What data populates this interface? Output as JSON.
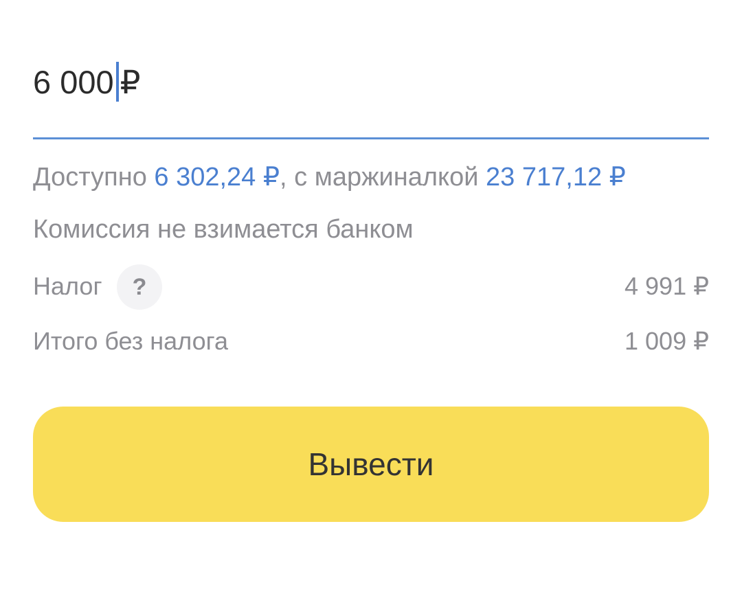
{
  "amount": {
    "value": "6 000",
    "currency": "₽"
  },
  "available": {
    "prefix": "Доступно ",
    "amount": "6 302,24 ₽",
    "middle": ", с маржиналкой ",
    "margin_amount": "23 717,12 ₽"
  },
  "commission_text": "Комиссия не взимается банком",
  "tax": {
    "label": "Налог",
    "help_symbol": "?",
    "value": "4 991 ₽"
  },
  "total": {
    "label": "Итого без налога",
    "value": "1 009 ₽"
  },
  "withdraw_button": {
    "label": "Вывести"
  },
  "colors": {
    "accent_blue": "#4a7fd0",
    "button_yellow": "#f9dd58",
    "muted_text": "#8e8e93"
  }
}
